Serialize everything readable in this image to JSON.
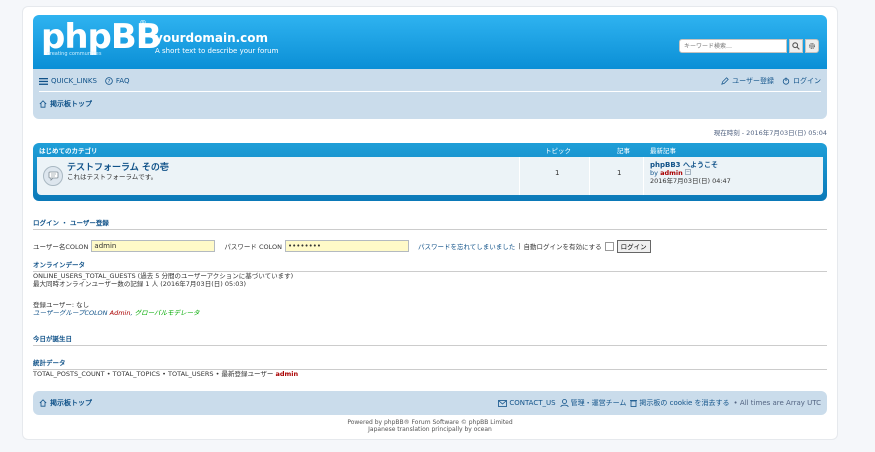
{
  "header": {
    "logo_text": "phpBB",
    "logo_reg": "®",
    "logo_sub": "creating communities",
    "site_title": "yourdomain.com",
    "site_desc": "A short text to describe your forum",
    "search_placeholder": "キーワード検索…"
  },
  "nav": {
    "quick_links": "QUICK_LINKS",
    "faq": "FAQ",
    "register": "ユーザー登録",
    "login": "ログイン",
    "breadcrumb": "掲示板トップ"
  },
  "time_line": "現在時刻 - 2016年7月03日(日) 05:04",
  "forum_table": {
    "category": "はじめてのカテゴリ",
    "col_topics": "トピック",
    "col_posts": "記事",
    "col_last": "最新記事",
    "rows": [
      {
        "name": "テストフォーラム その壱",
        "desc": "これはテストフォーラムです。",
        "topics": "1",
        "posts": "1",
        "last_title": "phpBB3 へようこそ",
        "last_by": "by",
        "last_user": "admin",
        "last_time": "2016年7月03日(日) 04:47"
      }
    ]
  },
  "login_block": {
    "title": "ログイン ・ ユーザー登録",
    "username_label": "ユーザー名COLON",
    "username_value": "admin",
    "password_label": "パスワード COLON",
    "password_value": "••••••••",
    "forgot": "パスワードを忘れてしまいました",
    "sep": "|",
    "autologin": "自動ログインを有効にする",
    "login_button": "ログイン"
  },
  "online": {
    "title": "オンラインデータ",
    "line1": "ONLINE_USERS_TOTAL_GUESTS (過去 5 分間のユーザーアクションに基づいています)",
    "line2": "最大同時オンラインユーザー数の記録 1 人 (2016年7月03日(日) 05:03)",
    "registered": "登録ユーザー: なし",
    "groups_prefix": "ユーザーグループCOLON",
    "group_admin": "Admin",
    "group_sep": ",",
    "group_mod": "グローバルモデレータ"
  },
  "birthdays": {
    "title": "今日が誕生日"
  },
  "stats": {
    "title": "統計データ",
    "line": "TOTAL_POSTS_COUNT • TOTAL_TOPICS • TOTAL_USERS • 最新登録ユーザー",
    "newest": "admin"
  },
  "footer": {
    "breadcrumb": "掲示板トップ",
    "contact": "CONTACT_US",
    "team": "管理・運営チーム",
    "cookies": "掲示板の cookie を消去する",
    "timezone": "• All times are Array UTC",
    "powered": "Powered by phpBB® Forum Software © phpBB Limited",
    "translation": "Japanese translation principally by ocean"
  },
  "colors": {
    "header_blue": "#0b8fd6",
    "nav_bg": "#cadceb",
    "link": "#105289",
    "admin_red": "#aa0000",
    "mod_green": "#00aa00"
  }
}
